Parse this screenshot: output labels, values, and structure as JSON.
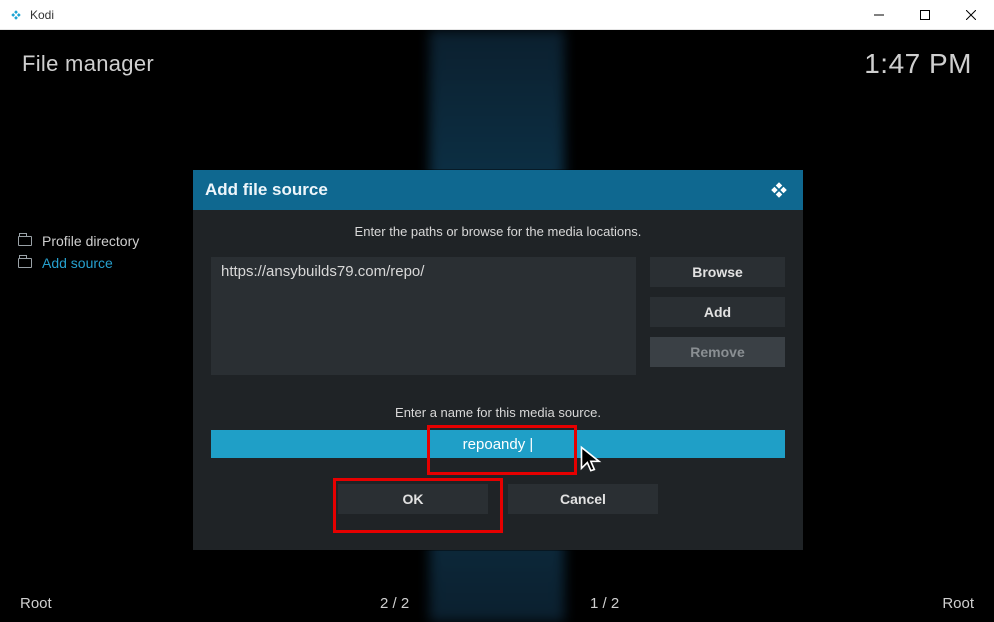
{
  "window": {
    "app_name": "Kodi"
  },
  "header": {
    "breadcrumb": "File manager",
    "clock": "1:47 PM"
  },
  "left_panel": {
    "items": [
      {
        "label": "Profile directory",
        "active": false
      },
      {
        "label": "Add source",
        "active": true
      }
    ]
  },
  "footer": {
    "root_label_left": "Root",
    "count_left": "2 / 2",
    "count_right": "1 / 2",
    "root_label_right": "Root"
  },
  "dialog": {
    "title": "Add file source",
    "prompt_paths": "Enter the paths or browse for the media locations.",
    "path_value": "https://ansybuilds79.com/repo/",
    "browse_label": "Browse",
    "add_label": "Add",
    "remove_label": "Remove",
    "prompt_name": "Enter a name for this media source.",
    "name_value": "repoandy",
    "ok_label": "OK",
    "cancel_label": "Cancel"
  }
}
